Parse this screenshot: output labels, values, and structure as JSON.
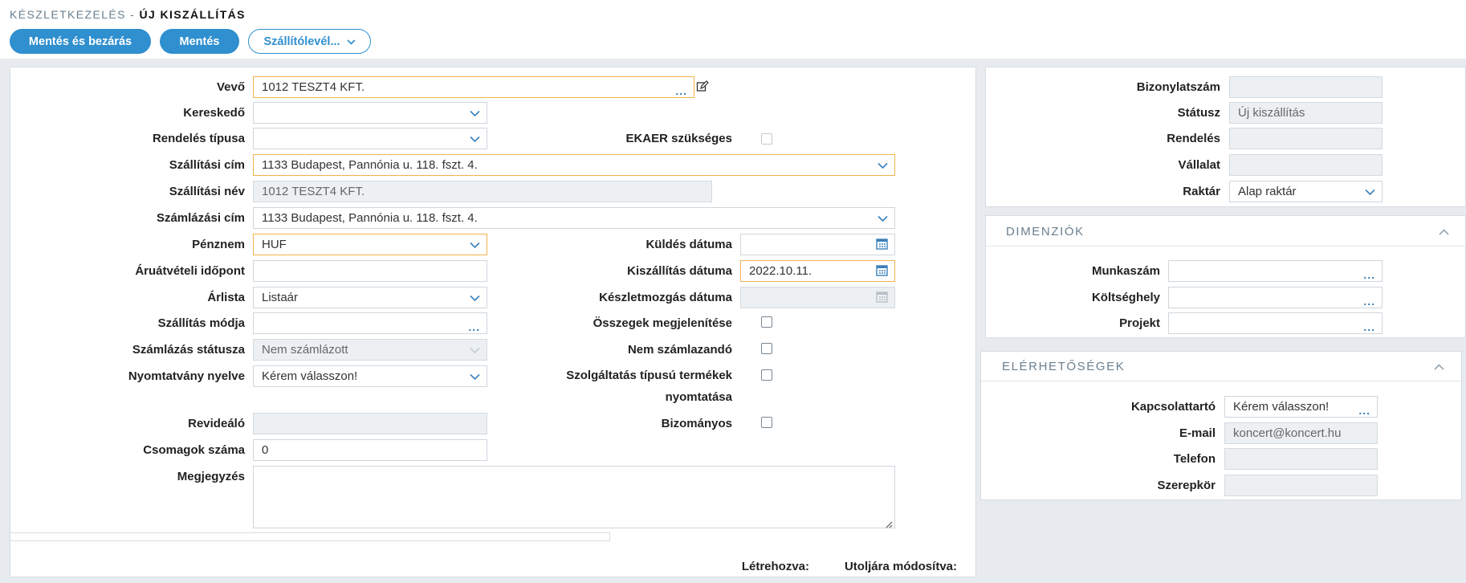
{
  "breadcrumb": {
    "parent": "KÉSZLETKEZELÉS -",
    "current": "ÚJ KISZÁLLÍTÁS"
  },
  "toolbar": {
    "save_close": "Mentés és bezárás",
    "save": "Mentés",
    "delivery_note": "Szállítólevél..."
  },
  "form": {
    "vevo": {
      "label": "Vevő",
      "value": "1012 TESZT4 KFT."
    },
    "kereskedo": {
      "label": "Kereskedő",
      "value": ""
    },
    "rendeles_tipusa": {
      "label": "Rendelés típusa",
      "value": ""
    },
    "ekaer": {
      "label": "EKAER szükséges"
    },
    "szallitasi_cim": {
      "label": "Szállítási cím",
      "value": "1133 Budapest, Pannónia u. 118. fszt. 4."
    },
    "szallitasi_nev": {
      "label": "Szállítási név",
      "value": "1012 TESZT4 KFT."
    },
    "szamlazasi_cim": {
      "label": "Számlázási cím",
      "value": "1133 Budapest, Pannónia u. 118. fszt. 4."
    },
    "penznem": {
      "label": "Pénznem",
      "value": "HUF"
    },
    "kuldes_datuma": {
      "label": "Küldés dátuma",
      "value": ""
    },
    "aruatveteli": {
      "label": "Áruátvételi időpont",
      "value": ""
    },
    "kiszallitas_datuma": {
      "label": "Kiszállítás dátuma",
      "value": "2022.10.11."
    },
    "arlista": {
      "label": "Árlista",
      "value": "Listaár"
    },
    "keszletmozgas_datuma": {
      "label": "Készletmozgás dátuma",
      "value": ""
    },
    "szallitas_modja": {
      "label": "Szállítás módja",
      "value": ""
    },
    "osszegek": {
      "label": "Összegek megjelenítése"
    },
    "szamlazas_statusza": {
      "label": "Számlázás státusza",
      "value": "Nem számlázott"
    },
    "nem_szamlazando": {
      "label": "Nem számlazandó"
    },
    "nyomtatvany_nyelve": {
      "label": "Nyomtatvány nyelve",
      "value": "Kérem válasszon!"
    },
    "szolgaltatas": {
      "label": "Szolgáltatás típusú termékek nyomtatása"
    },
    "revidealo": {
      "label": "Revideáló",
      "value": ""
    },
    "bizomanyos": {
      "label": "Bizományos"
    },
    "csomagok": {
      "label": "Csomagok száma",
      "value": "0"
    },
    "megjegyzes": {
      "label": "Megjegyzés",
      "value": ""
    },
    "letrehozva": "Létrehozva:",
    "utoljara": "Utoljára módosítva:"
  },
  "info": {
    "bizonylatszam": {
      "label": "Bizonylatszám",
      "value": ""
    },
    "statusz": {
      "label": "Státusz",
      "value": "Új kiszállítás"
    },
    "rendeles": {
      "label": "Rendelés",
      "value": ""
    },
    "vallalat": {
      "label": "Vállalat",
      "value": ""
    },
    "raktar": {
      "label": "Raktár",
      "value": "Alap raktár"
    }
  },
  "dimenziok": {
    "title": "DIMENZIÓK",
    "munkaszam": {
      "label": "Munkaszám",
      "value": ""
    },
    "koltseghely": {
      "label": "Költséghely",
      "value": ""
    },
    "projekt": {
      "label": "Projekt",
      "value": ""
    }
  },
  "elerhetosegek": {
    "title": "ELÉRHETŐSÉGEK",
    "kapcsolattarto": {
      "label": "Kapcsolattartó",
      "value": "Kérem válasszon!"
    },
    "email": {
      "label": "E-mail",
      "value": "koncert@koncert.hu"
    },
    "telefon": {
      "label": "Telefon",
      "value": ""
    },
    "szerepkor": {
      "label": "Szerepkör",
      "value": ""
    }
  },
  "colors": {
    "accent": "#2f8fcf",
    "highlight_border": "#f0b44c",
    "band": "#e7ebef"
  }
}
